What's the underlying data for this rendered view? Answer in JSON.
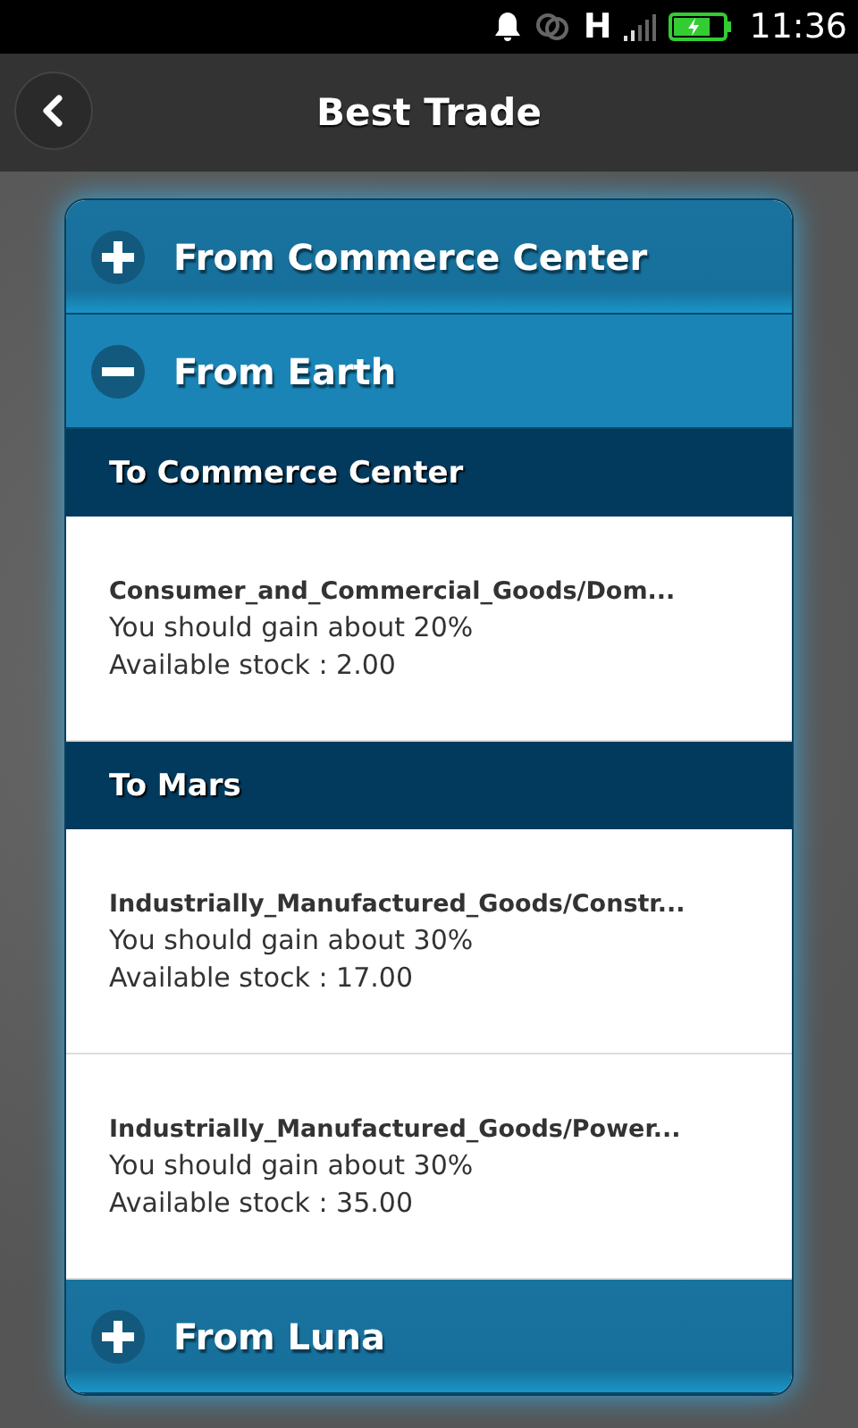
{
  "status_bar": {
    "network": "H",
    "time": "11:36"
  },
  "header": {
    "title": "Best Trade"
  },
  "sections": [
    {
      "title": "From Commerce Center",
      "expanded": false
    },
    {
      "title": "From Earth",
      "expanded": true,
      "groups": [
        {
          "title": "To Commerce Center",
          "items": [
            {
              "name": "Consumer_and_Commercial_Goods/Dom...",
              "gain": "You should gain about 20%",
              "stock": "Available stock : 2.00"
            }
          ]
        },
        {
          "title": "To Mars",
          "items": [
            {
              "name": "Industrially_Manufactured_Goods/Constr...",
              "gain": "You should gain about 30%",
              "stock": "Available stock : 17.00"
            },
            {
              "name": "Industrially_Manufactured_Goods/Power...",
              "gain": "You should gain about 30%",
              "stock": "Available stock : 35.00"
            }
          ]
        }
      ]
    },
    {
      "title": "From Luna",
      "expanded": false
    }
  ]
}
